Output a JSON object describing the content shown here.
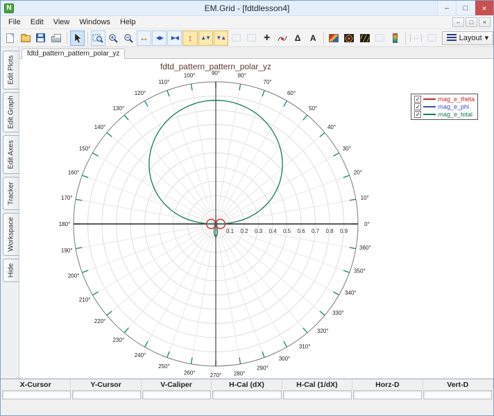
{
  "window": {
    "title": "EM.Grid - [fdtdlesson4]",
    "app_icon_letter": "N",
    "controls": {
      "minimize": "–",
      "maximize": "□",
      "close": "×"
    }
  },
  "mdi_controls": {
    "minimize": "–",
    "restore": "□",
    "close": "×"
  },
  "menu": {
    "items": [
      "File",
      "Edit",
      "View",
      "Windows",
      "Help"
    ]
  },
  "toolbar": {
    "layout_label": "Layout",
    "glyphs": {
      "plus": "+",
      "delta": "Δ",
      "text": "A",
      "h_arrows": "↔",
      "h_expand": "◀▶",
      "h_fit": "▶◀",
      "v_arrows": "↕",
      "v_expand": "▲▼",
      "v_fit": "▼▲",
      "measure": "↔",
      "caret": "▾"
    }
  },
  "side_tabs": [
    "Edit Plots",
    "Edit Graph",
    "Edit Axes",
    "Tracker",
    "Workspace",
    "Hide"
  ],
  "doc_tab": "fdtd_pattern_pattern_polar_yz",
  "chart_data": {
    "type": "polar",
    "title": "fdtd_pattern_pattern_polar_yz",
    "title_color": "#5a3a2e",
    "r_max": 1.0,
    "radial_ticks": [
      0.1,
      0.2,
      0.3,
      0.4,
      0.5,
      0.6,
      0.7,
      0.8,
      0.9
    ],
    "angle_tick_step_deg": 10,
    "angle_labels_deg": [
      0,
      10,
      20,
      30,
      40,
      50,
      60,
      70,
      80,
      90,
      100,
      110,
      120,
      130,
      140,
      150,
      160,
      170,
      180,
      190,
      200,
      210,
      220,
      230,
      240,
      250,
      260,
      270,
      280,
      290,
      300,
      310,
      320,
      330,
      340,
      350,
      360
    ],
    "orientation": "0 deg right, 90 deg top, counterclockwise",
    "grid": true,
    "grid_color": "#dddddd",
    "spoke_color": "#e7e7e7",
    "tick_color": "#1a8a7c",
    "axis_color": "#222222",
    "legend": {
      "position": "top-right",
      "check_glyph": "✓",
      "entries": [
        {
          "label": "mag_e_theta",
          "color": "#c62828",
          "checked": true
        },
        {
          "label": "mag_e_phi",
          "color": "#3d49c4",
          "checked": true
        },
        {
          "label": "mag_e_total",
          "color": "#157a55",
          "checked": true
        }
      ]
    },
    "series": [
      {
        "name": "mag_e_theta",
        "color": "#c62828",
        "shape": "small horizontal figure-eight at origin",
        "peak_r": 0.065,
        "peak_angles_deg": [
          0,
          180
        ],
        "nulls_deg": [
          90,
          270
        ],
        "model": {
          "kind": "cos_lobes",
          "a": 0.065,
          "exp": 1
        }
      },
      {
        "name": "mag_e_phi",
        "color": "#3d49c4",
        "shape": "negligible, hidden at origin",
        "peak_r": 0.012,
        "peak_angles_deg": [
          0,
          180
        ],
        "model": {
          "kind": "cos_lobes",
          "a": 0.012,
          "exp": 1
        }
      },
      {
        "name": "mag_e_total",
        "color": "#157a55",
        "shape": "single broad main lobe pointing up with narrow small backlobe at 270 deg",
        "peak_r": 0.87,
        "peak_angle_deg": 90,
        "back_peak_r": 0.09,
        "model": {
          "kind": "main_back",
          "a": 0.87,
          "exp": 0.8,
          "back_a": 0.09,
          "back_exp": 20
        }
      }
    ]
  },
  "status_bar": {
    "headers": [
      "X-Cursor",
      "Y-Cursor",
      "V-Caliper",
      "H-Cal (dX)",
      "H-Cal (1/dX)",
      "Horz-D",
      "Vert-D"
    ],
    "values": [
      "",
      "",
      "",
      "",
      "",
      "",
      ""
    ]
  }
}
